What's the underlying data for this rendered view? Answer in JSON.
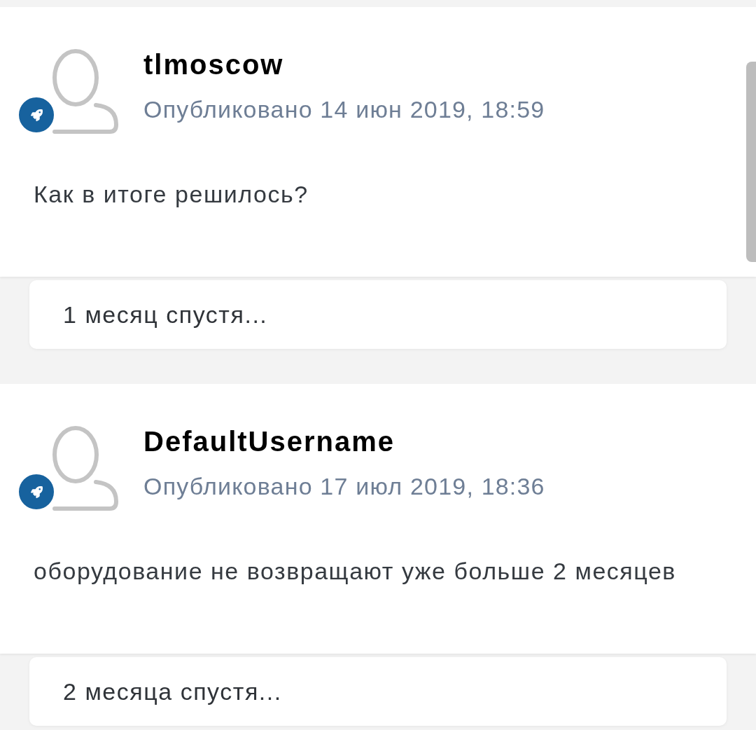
{
  "stream": [
    {
      "kind": "post",
      "author": "tlmoscow",
      "published": "Опубликовано 14 июн 2019, 18:59",
      "body": "Как в итоге решилось?"
    },
    {
      "kind": "gap",
      "label": "1 месяц спустя..."
    },
    {
      "kind": "post",
      "author": "DefaultUsername",
      "published": "Опубликовано 17 июл 2019, 18:36",
      "body": "оборудование не возвращают уже больше 2 месяцев"
    },
    {
      "kind": "gap",
      "label": "2 месяца спустя..."
    }
  ]
}
